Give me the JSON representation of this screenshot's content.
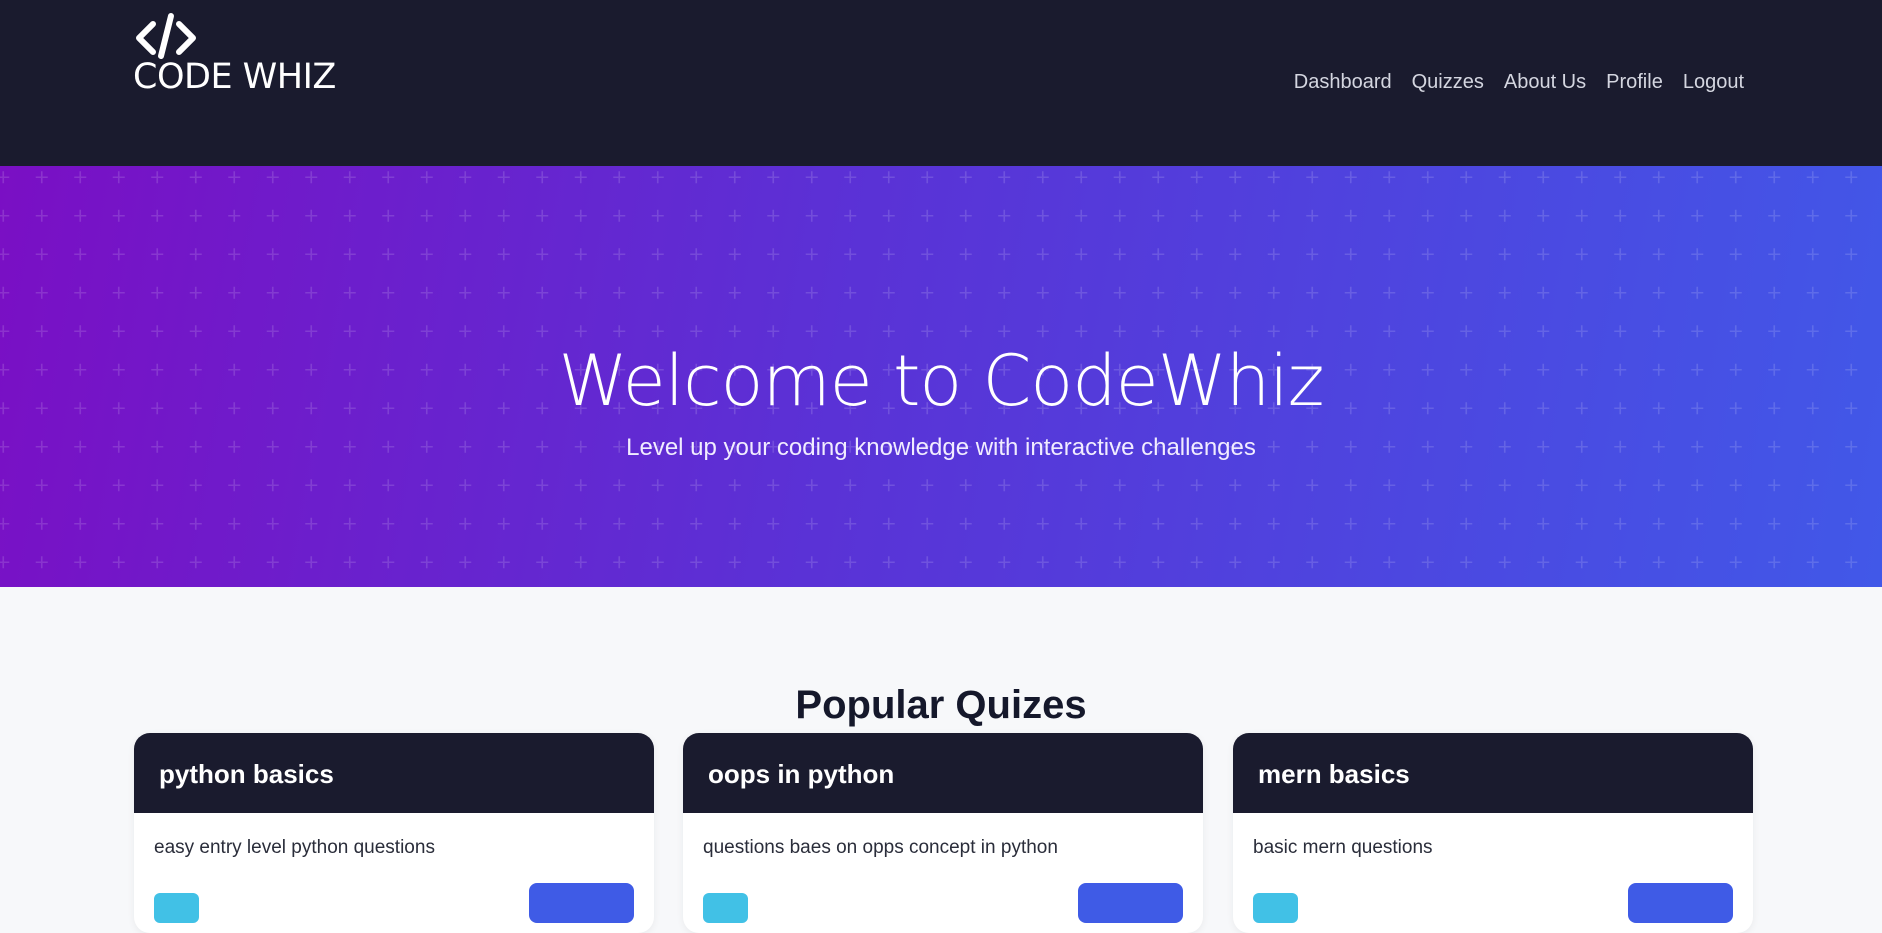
{
  "brand": {
    "name": "CODE WHIZ",
    "logo_icon": "code-brackets-icon"
  },
  "nav": {
    "items": [
      {
        "label": "Dashboard"
      },
      {
        "label": "Quizzes"
      },
      {
        "label": "About Us"
      },
      {
        "label": "Profile"
      },
      {
        "label": "Logout"
      }
    ]
  },
  "hero": {
    "title": "Welcome to CodeWhiz",
    "subtitle": "Level up your coding knowledge with interactive challenges"
  },
  "quizzes": {
    "section_title": "Popular Quizes",
    "cards": [
      {
        "title": "python basics",
        "description": "easy entry level python questions"
      },
      {
        "title": "oops in python",
        "description": "questions baes on opps concept in python"
      },
      {
        "title": "mern basics",
        "description": "basic mern questions"
      }
    ]
  },
  "colors": {
    "navbar_bg": "#1a1b2e",
    "hero_gradient_start": "#7a0fc4",
    "hero_gradient_end": "#4158e8",
    "page_bg": "#f7f8fa",
    "badge": "#41c1e6",
    "button": "#3f5be6"
  }
}
